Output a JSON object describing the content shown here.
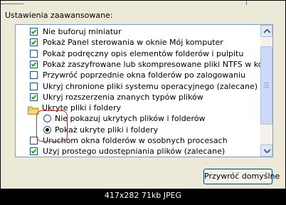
{
  "section_label": "Ustawienia zaawansowane:",
  "options": [
    {
      "type": "checkbox",
      "checked": true,
      "label": "Nie buforuj miniatur"
    },
    {
      "type": "checkbox",
      "checked": true,
      "label": "Pokaż Panel sterowania w oknie Mój komputer"
    },
    {
      "type": "checkbox",
      "checked": false,
      "label": "Pokaż podręczny opis elementów folderów i pulpitu"
    },
    {
      "type": "checkbox",
      "checked": true,
      "label": "Pokaż zaszyfrowane lub skompresowane pliki NTFS w kolorze"
    },
    {
      "type": "checkbox",
      "checked": false,
      "label": "Przywróć poprzednie okna folderów po zalogowaniu"
    },
    {
      "type": "checkbox",
      "checked": false,
      "label": "Ukryj chronione pliki systemu operacyjnego (zalecane)"
    },
    {
      "type": "checkbox",
      "checked": true,
      "label": "Ukryj rozszerzenia znanych typów plików"
    },
    {
      "type": "folder",
      "label": "Ukryte pliki i foldery"
    },
    {
      "type": "radio",
      "checked": false,
      "label": "Nie pokazuj ukrytych plików i folderów"
    },
    {
      "type": "radio",
      "checked": true,
      "label": "Pokaż ukryte pliki i foldery"
    },
    {
      "type": "checkbox",
      "checked": false,
      "label": "Uruchom okna folderów w osobnych procesach"
    },
    {
      "type": "checkbox",
      "checked": true,
      "label": "Użyj prostego udostępniania plików (zalecane)"
    }
  ],
  "restore_button": "Przywróć domyślne",
  "caption": "417x282 71kb JPEG"
}
